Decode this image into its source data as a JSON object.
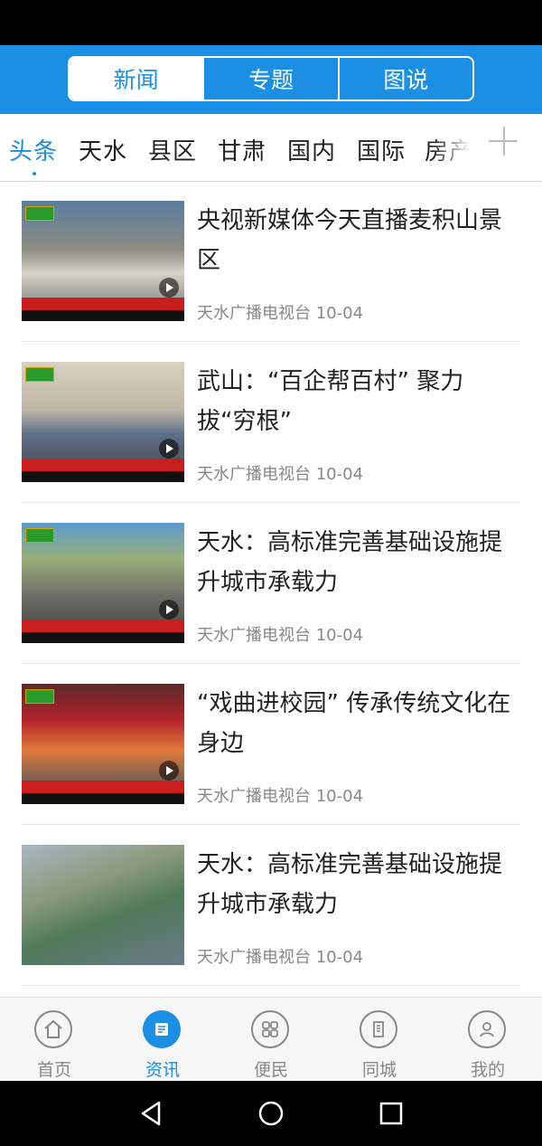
{
  "colors": {
    "accent": "#1a8fe3",
    "header_bg": "#1a8fe3"
  },
  "segments": [
    {
      "label": "新闻",
      "active": true
    },
    {
      "label": "专题",
      "active": false
    },
    {
      "label": "图说",
      "active": false
    }
  ],
  "channels": [
    "头条",
    "天水",
    "县区",
    "甘肃",
    "国内",
    "国际",
    "房产"
  ],
  "active_channel": "头条",
  "news": [
    {
      "title": "央视新媒体今天直播麦积山景区",
      "source": "天水广播电视台",
      "date": "10-04",
      "video": true
    },
    {
      "title": "武山：“百企帮百村” 聚力拔“穷根”",
      "source": "天水广播电视台",
      "date": "10-04",
      "video": true
    },
    {
      "title": "天水：高标准完善基础设施提升城市承载力",
      "source": "天水广播电视台",
      "date": "10-04",
      "video": true
    },
    {
      "title": "“戏曲进校园” 传承传统文化在身边",
      "source": "天水广播电视台",
      "date": "10-04",
      "video": true
    },
    {
      "title": " 天水：高标准完善基础设施提升城市承载力",
      "source": "天水广播电视台",
      "date": "10-04",
      "video": false
    }
  ],
  "tabs": [
    {
      "label": "首页",
      "icon": "home-icon"
    },
    {
      "label": "资讯",
      "icon": "news-icon",
      "active": true
    },
    {
      "label": "便民",
      "icon": "grid-icon"
    },
    {
      "label": "同城",
      "icon": "building-icon"
    },
    {
      "label": "我的",
      "icon": "user-icon"
    }
  ],
  "system_nav": [
    "back-icon",
    "home-circle-icon",
    "recents-icon"
  ]
}
